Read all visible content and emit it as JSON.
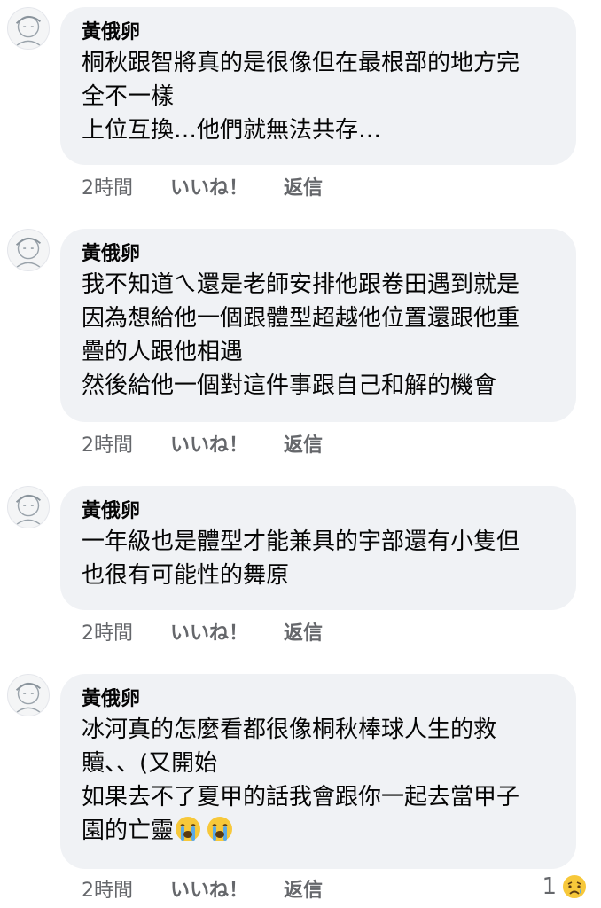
{
  "comments": [
    {
      "author": "黃俄卵",
      "lines": [
        "桐秋跟智將真的是很像但在最根部的地方完",
        "全不一樣",
        "上位互換…他們就無法共存…"
      ],
      "time": "2時間",
      "like_label": "いいね！",
      "reply_label": "返信"
    },
    {
      "author": "黃俄卵",
      "lines": [
        "我不知道ㄟ還是老師安排他跟卷田遇到就是",
        "因為想給他一個跟體型超越他位置還跟他重",
        "疊的人跟他相遇",
        "然後給他一個對這件事跟自己和解的機會"
      ],
      "time": "2時間",
      "like_label": "いいね！",
      "reply_label": "返信"
    },
    {
      "author": "黃俄卵",
      "lines": [
        "一年級也是體型才能兼具的宇部還有小隻但",
        "也很有可能性的舞原"
      ],
      "time": "2時間",
      "like_label": "いいね！",
      "reply_label": "返信"
    },
    {
      "author": "黃俄卵",
      "lines": [
        "冰河真的怎麼看都很像桐秋棒球人生的救",
        "贖、、(又開始",
        "如果去不了夏甲的話我會跟你一起去當甲子",
        "園的亡靈"
      ],
      "emoji": [
        "loudly-crying-face-icon",
        "loudly-crying-face-icon"
      ],
      "time": "2時間",
      "like_label": "いいね！",
      "reply_label": "返信",
      "reaction": {
        "count": "1",
        "icon": "sad-reaction-icon"
      }
    }
  ]
}
